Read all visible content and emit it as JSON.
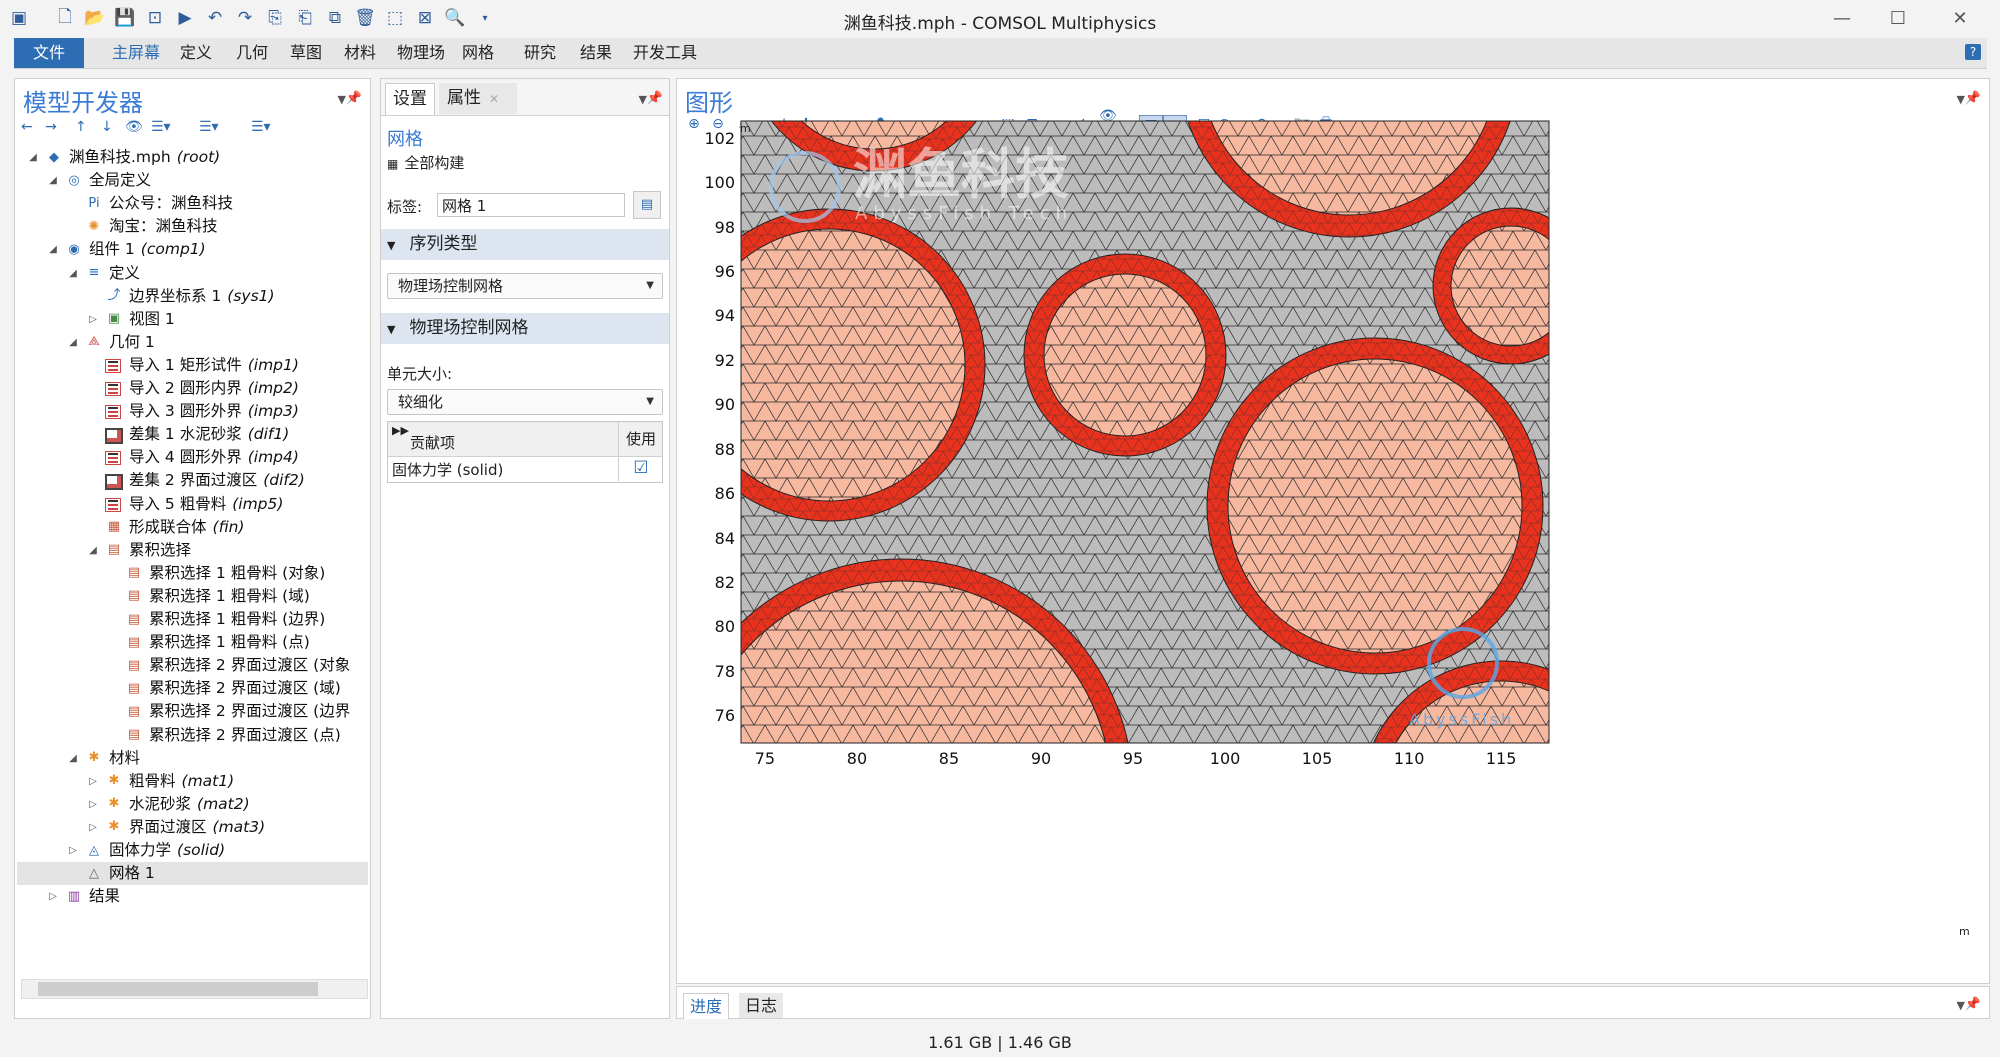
{
  "window": {
    "title": "渊鱼科技.mph - COMSOL Multiphysics",
    "minimize_icon": "minimize-icon",
    "maximize_icon": "maximize-icon",
    "close_icon": "close-icon"
  },
  "ribbon": {
    "tabs": [
      "文件",
      "主屏幕",
      "定义",
      "几何",
      "草图",
      "材料",
      "物理场",
      "网格",
      "研究",
      "结果",
      "开发工具"
    ],
    "active_tab": "主屏幕",
    "help": "?"
  },
  "model_builder": {
    "title": "模型开发器",
    "tree": [
      {
        "label": "渊鱼科技.mph",
        "tag": "(root)",
        "level": 0,
        "expanded": true,
        "icon": "model-icon"
      },
      {
        "label": "全局定义",
        "tag": "",
        "level": 1,
        "expanded": true,
        "icon": "globe-icon"
      },
      {
        "label": "公众号：渊鱼科技",
        "tag": "",
        "level": 2,
        "icon": "parameter-icon"
      },
      {
        "label": "淘宝：渊鱼科技",
        "tag": "",
        "level": 2,
        "icon": "material-icon"
      },
      {
        "label": "组件 1",
        "tag": "(comp1)",
        "level": 1,
        "expanded": true,
        "icon": "component-icon"
      },
      {
        "label": "定义",
        "tag": "",
        "level": 2,
        "expanded": true,
        "icon": "definitions-icon"
      },
      {
        "label": "边界坐标系 1",
        "tag": "(sys1)",
        "level": 3,
        "icon": "coordinate-system-icon"
      },
      {
        "label": "视图 1",
        "tag": "",
        "level": 3,
        "collapsed": true,
        "icon": "view-icon"
      },
      {
        "label": "几何 1",
        "tag": "",
        "level": 2,
        "expanded": true,
        "icon": "geometry-icon"
      },
      {
        "label": "导入 1 矩形试件",
        "tag": "(imp1)",
        "level": 3,
        "icon": "import-icon"
      },
      {
        "label": "导入 2 圆形内界",
        "tag": "(imp2)",
        "level": 3,
        "icon": "import-icon"
      },
      {
        "label": "导入 3 圆形外界",
        "tag": "(imp3)",
        "level": 3,
        "icon": "import-icon"
      },
      {
        "label": "差集 1 水泥砂浆",
        "tag": "(dif1)",
        "level": 3,
        "icon": "difference-icon"
      },
      {
        "label": "导入 4 圆形外界",
        "tag": "(imp4)",
        "level": 3,
        "icon": "import-icon"
      },
      {
        "label": "差集 2 界面过渡区",
        "tag": "(dif2)",
        "level": 3,
        "icon": "difference-icon"
      },
      {
        "label": "导入 5 粗骨料",
        "tag": "(imp5)",
        "level": 3,
        "icon": "import-icon"
      },
      {
        "label": "形成联合体",
        "tag": "(fin)",
        "level": 3,
        "icon": "form-union-icon"
      },
      {
        "label": "累积选择",
        "tag": "",
        "level": 3,
        "expanded": true,
        "icon": "cumulative-selection-icon"
      },
      {
        "label": "累积选择 1 粗骨料 (对象)",
        "tag": "",
        "level": 4,
        "icon": "selection-icon"
      },
      {
        "label": "累积选择 1 粗骨料 (域)",
        "tag": "",
        "level": 4,
        "icon": "selection-icon"
      },
      {
        "label": "累积选择 1 粗骨料 (边界)",
        "tag": "",
        "level": 4,
        "icon": "selection-icon"
      },
      {
        "label": "累积选择 1 粗骨料 (点)",
        "tag": "",
        "level": 4,
        "icon": "selection-icon"
      },
      {
        "label": "累积选择 2 界面过渡区 (对象",
        "tag": "",
        "level": 4,
        "icon": "selection-icon"
      },
      {
        "label": "累积选择 2 界面过渡区 (域)",
        "tag": "",
        "level": 4,
        "icon": "selection-icon"
      },
      {
        "label": "累积选择 2 界面过渡区 (边界",
        "tag": "",
        "level": 4,
        "icon": "selection-icon"
      },
      {
        "label": "累积选择 2 界面过渡区 (点)",
        "tag": "",
        "level": 4,
        "icon": "selection-icon"
      },
      {
        "label": "材料",
        "tag": "",
        "level": 2,
        "expanded": true,
        "icon": "materials-icon"
      },
      {
        "label": "粗骨料",
        "tag": "(mat1)",
        "level": 3,
        "collapsed": true,
        "icon": "materials-icon"
      },
      {
        "label": "水泥砂浆",
        "tag": "(mat2)",
        "level": 3,
        "collapsed": true,
        "icon": "materials-icon"
      },
      {
        "label": "界面过渡区",
        "tag": "(mat3)",
        "level": 3,
        "collapsed": true,
        "icon": "materials-icon"
      },
      {
        "label": "固体力学",
        "tag": "(solid)",
        "level": 2,
        "collapsed": true,
        "icon": "solid-mechanics-icon"
      },
      {
        "label": "网格 1",
        "tag": "",
        "level": 2,
        "selected": true,
        "icon": "mesh-icon"
      },
      {
        "label": "结果",
        "tag": "",
        "level": 1,
        "collapsed": true,
        "icon": "results-icon"
      }
    ]
  },
  "settings": {
    "tabs": [
      "设置",
      "属性"
    ],
    "node_title": "网格",
    "build_all": "全部构建",
    "label_caption": "标签:",
    "label_value": "网格 1",
    "section1": "序列类型",
    "sequence_type": "物理场控制网格",
    "section2": "物理场控制网格",
    "element_size_caption": "单元大小:",
    "element_size": "较细化",
    "table_header_contrib": "贡献项",
    "table_header_use": "使用",
    "table_row": "固体力学 (solid)",
    "table_row_checked": true
  },
  "graphics": {
    "title": "图形",
    "unit_label": "m",
    "watermark_cn": "渊鱼科技",
    "watermark_en": "AbyssFish Tech",
    "watermark2": "AbyssFish",
    "x_ticks": [
      "75",
      "80",
      "85",
      "90",
      "95",
      "100",
      "105",
      "110",
      "115"
    ],
    "y_ticks": [
      "102",
      "100",
      "98",
      "96",
      "94",
      "92",
      "90",
      "88",
      "86",
      "84",
      "82",
      "80",
      "78",
      "76"
    ],
    "colors": {
      "matrix": "#bcbcbc",
      "itz": "#e8321e",
      "aggregate": "#f7b8a0",
      "mesh": "#2a2a2a"
    }
  },
  "bottom": {
    "tabs": [
      "进度",
      "日志"
    ]
  },
  "status": {
    "memory": "1.61 GB | 1.46 GB"
  }
}
